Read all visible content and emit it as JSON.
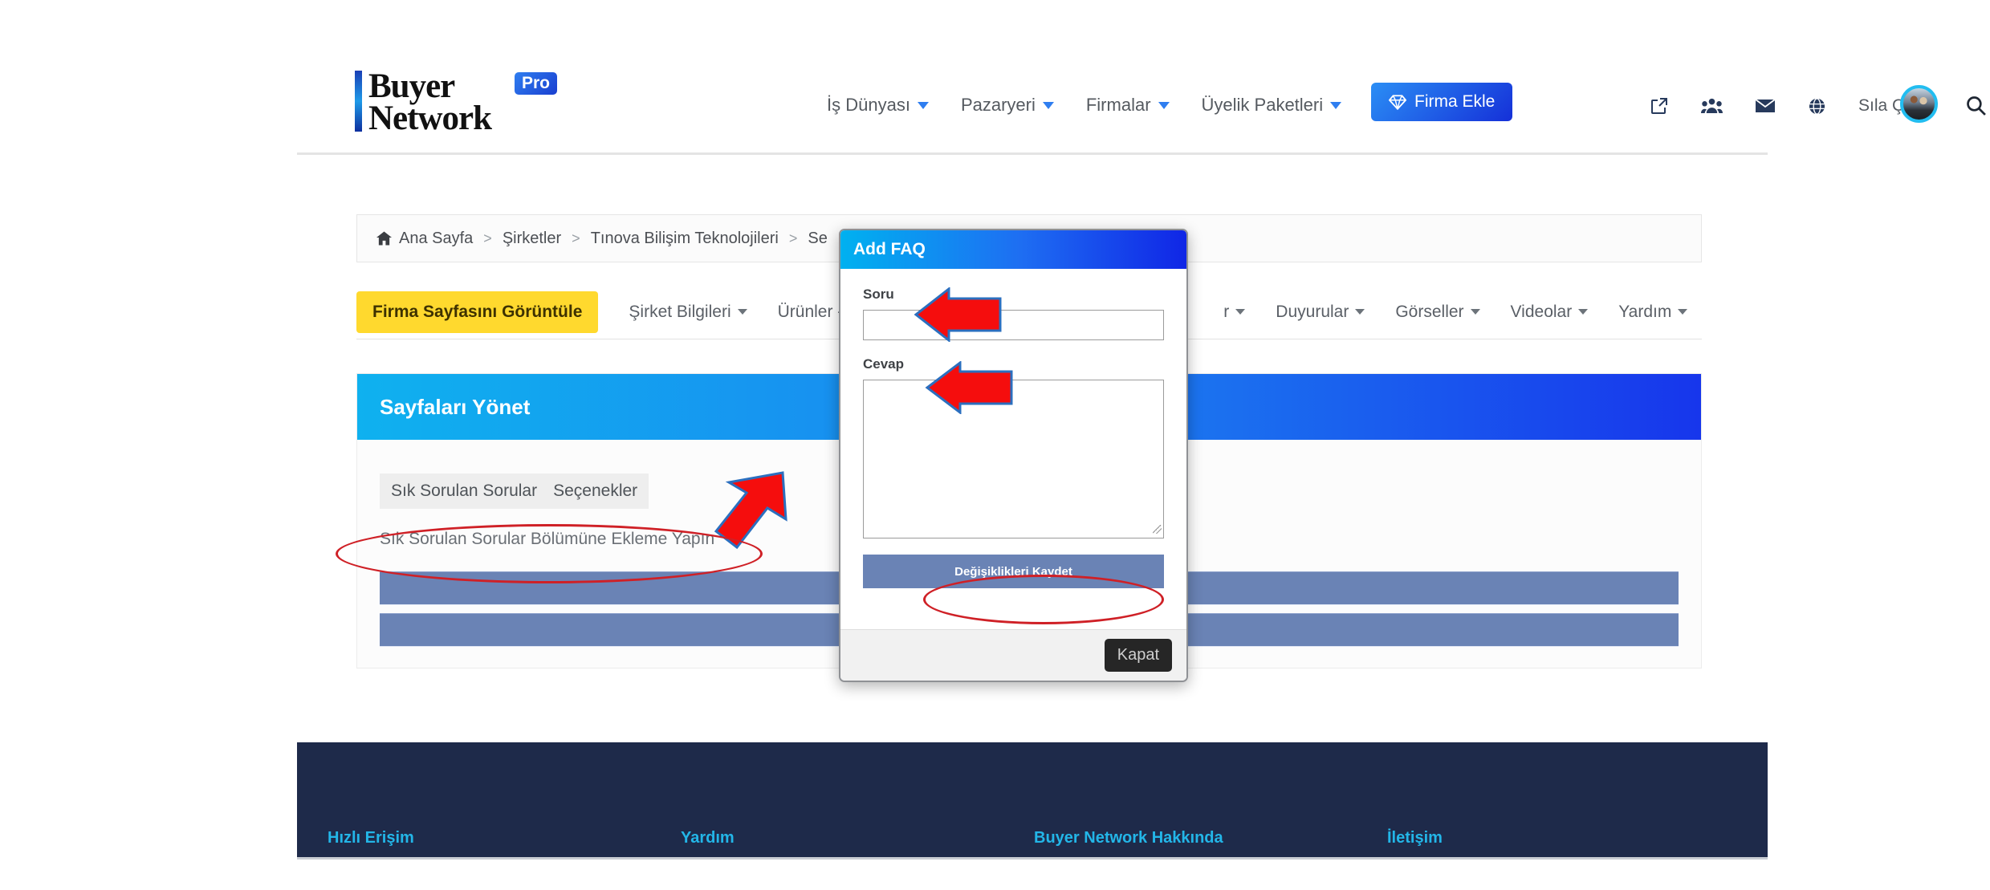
{
  "brand": {
    "line1": "Buyer",
    "line2": "Network",
    "badge": "Pro"
  },
  "topnav": {
    "links": [
      {
        "label": "İş Dünyası",
        "icon": "chevron-down-icon"
      },
      {
        "label": "Pazaryeri",
        "icon": "chevron-down-icon"
      },
      {
        "label": "Firmalar",
        "icon": "chevron-down-icon"
      },
      {
        "label": "Üyelik Paketleri",
        "icon": "chevron-down-icon"
      }
    ],
    "cta": {
      "label": "Firma Ekle",
      "icon": "diamond-icon",
      "color": "#1c62ef"
    },
    "icons": [
      "external-link-icon",
      "users-group-icon",
      "envelope-icon",
      "globe-icon"
    ],
    "username": "Sıla Çil",
    "search_icon": "search-icon"
  },
  "breadcrumb": {
    "home_icon": "home-icon",
    "items": [
      "Ana Sayfa",
      "Şirketler",
      "Tınova Bilişim Teknolojileri",
      "Se"
    ],
    "separator": ">"
  },
  "subnav": {
    "primary": "Firma Sayfasını Görüntüle",
    "tabs": [
      "Şirket Bilgileri",
      "Ürünler - H",
      "r",
      "Duyurular",
      "Görseller",
      "Videolar",
      "Yardım"
    ]
  },
  "card": {
    "title": "Sayfaları Yönet",
    "chips": [
      "Sık Sorulan Sorular",
      "Seçenekler"
    ],
    "hint": "Sık Sorulan Sorular Bölümüne Ekleme Yapın",
    "accent_start": "#0fb1ef",
    "accent_end": "#1736ec",
    "row_color": "#6a83b5"
  },
  "modal": {
    "title": "Add FAQ",
    "question_label": "Soru",
    "question_value": "",
    "question_placeholder": "",
    "answer_label": "Cevap",
    "answer_value": "",
    "answer_placeholder": "",
    "save_label": "Değişiklikleri Kaydet",
    "close_label": "Kapat",
    "header_start": "#00b1f0",
    "header_end": "#1026e6"
  },
  "annotations": {
    "color": "#cf2026",
    "arrow_color": "#f50d0d",
    "arrows": [
      {
        "name": "arrow-to-chips",
        "direction": "down-left"
      },
      {
        "name": "arrow-to-soru",
        "direction": "left"
      },
      {
        "name": "arrow-to-cevap",
        "direction": "left"
      }
    ],
    "ellipses": [
      {
        "name": "ellipse-hint-text"
      },
      {
        "name": "ellipse-save-button"
      }
    ]
  },
  "footer": {
    "background": "#1e2a4a",
    "heading_color": "#23b6e8",
    "columns": [
      {
        "heading": "Hızlı Erişim",
        "links": [
          "",
          ""
        ]
      },
      {
        "heading": "Yardım",
        "links": [
          "",
          ""
        ]
      },
      {
        "heading": "Buyer Network Hakkında",
        "links": [
          "",
          ""
        ]
      },
      {
        "heading": "İletişim",
        "links": [
          "",
          ""
        ]
      }
    ]
  }
}
